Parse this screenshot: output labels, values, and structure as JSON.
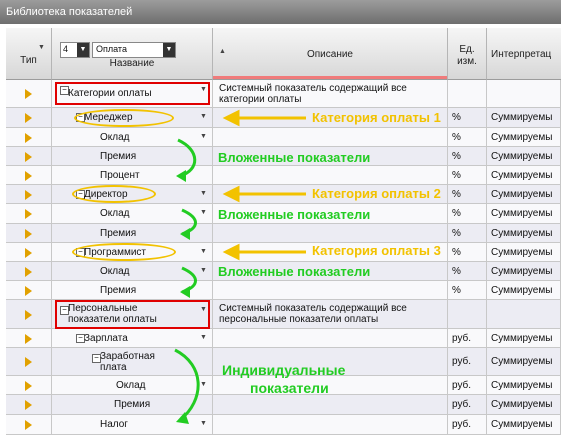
{
  "window": {
    "title": "Библиотека показателей"
  },
  "header": {
    "type_label": "Тип",
    "level_select": "4",
    "name_select": "Оплата",
    "name_label": "Название",
    "description_label": "Описание",
    "unit_label_1": "Ед.",
    "unit_label_2": "изм.",
    "interp_label": "Интерпретац"
  },
  "rows": [
    {
      "name": "Категории оплаты",
      "desc1": "Системный показатель содержащий все",
      "desc2": "категории оплаты",
      "unit": "",
      "interp": ""
    },
    {
      "name": "Мередж​ер",
      "desc1": "",
      "desc2": "",
      "unit": "%",
      "interp": "Суммируемы"
    },
    {
      "name": "Оклад",
      "desc1": "",
      "desc2": "",
      "unit": "%",
      "interp": "Суммируемы"
    },
    {
      "name": "Премия",
      "desc1": "",
      "desc2": "",
      "unit": "%",
      "interp": "Суммируемы"
    },
    {
      "name": "Процент",
      "desc1": "",
      "desc2": "",
      "unit": "%",
      "interp": "Суммируемы"
    },
    {
      "name": "Директор",
      "desc1": "",
      "desc2": "",
      "unit": "%",
      "interp": "Суммируемы"
    },
    {
      "name": "Оклад",
      "desc1": "",
      "desc2": "",
      "unit": "%",
      "interp": "Суммируемы"
    },
    {
      "name": "Премия",
      "desc1": "",
      "desc2": "",
      "unit": "%",
      "interp": "Суммируемы"
    },
    {
      "name": "Программист",
      "desc1": "",
      "desc2": "",
      "unit": "%",
      "interp": "Суммируемы"
    },
    {
      "name": "Оклад",
      "desc1": "",
      "desc2": "",
      "unit": "%",
      "interp": "Суммируемы"
    },
    {
      "name": "Премия",
      "desc1": "",
      "desc2": "",
      "unit": "%",
      "interp": "Суммируемы"
    },
    {
      "name1": "Персональные",
      "name2": "показатели оплаты",
      "desc1": "Системный показатель содержащий все",
      "desc2": "персональные показатели оплаты",
      "unit": "",
      "interp": ""
    },
    {
      "name": "Зарплата",
      "desc1": "",
      "desc2": "",
      "unit": "руб.",
      "interp": "Суммируемы"
    },
    {
      "name1": "Заработная",
      "name2": "плата",
      "desc1": "",
      "desc2": "",
      "unit": "руб.",
      "interp": "Суммируемы"
    },
    {
      "name": "Оклад",
      "desc1": "",
      "desc2": "",
      "unit": "руб.",
      "interp": "Суммируемы"
    },
    {
      "name": "Премия",
      "desc1": "",
      "desc2": "",
      "unit": "руб.",
      "interp": "Суммируемы"
    },
    {
      "name": "Налог",
      "desc1": "",
      "desc2": "",
      "unit": "руб.",
      "interp": "Суммируемы"
    }
  ],
  "annotations": {
    "cat1": "Категория оплаты 1",
    "cat2": "Категория оплаты 2",
    "cat3": "Категория оплаты 3",
    "nested": "Вложенные показатели",
    "indiv1": "Индивидуальные",
    "indiv2": "показатели"
  },
  "colors": {
    "annotation_yellow": "#f2c200",
    "annotation_green": "#22cc22",
    "highlight_red": "#e00000",
    "arrow_icon": "#e1a100"
  }
}
